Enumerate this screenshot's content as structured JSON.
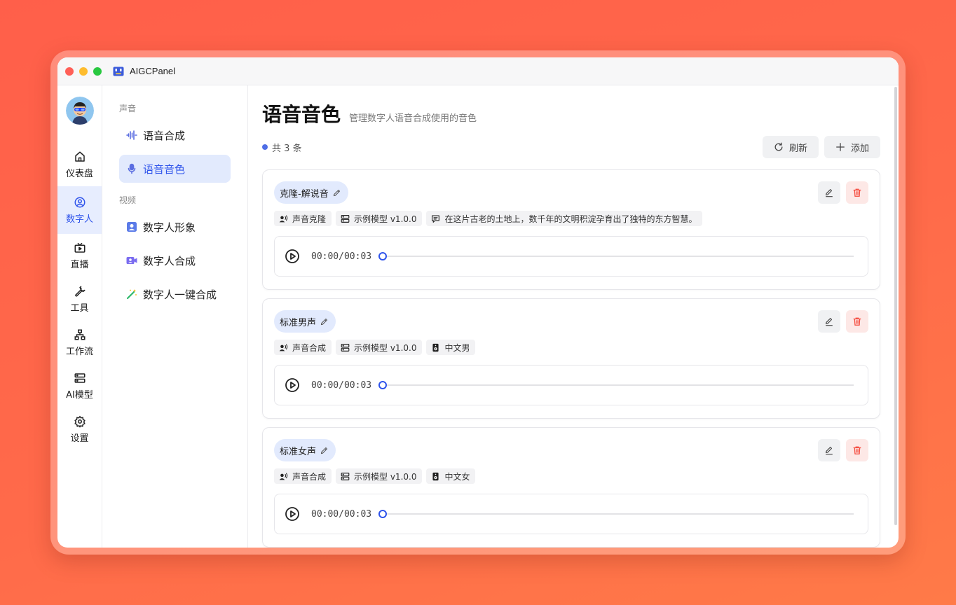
{
  "window": {
    "title": "AIGCPanel"
  },
  "rail": {
    "items": [
      {
        "label": "仪表盘"
      },
      {
        "label": "数字人"
      },
      {
        "label": "直播"
      },
      {
        "label": "工具"
      },
      {
        "label": "工作流"
      },
      {
        "label": "AI模型"
      },
      {
        "label": "设置"
      }
    ]
  },
  "subnav": {
    "sections": [
      {
        "label": "声音",
        "items": [
          {
            "label": "语音合成"
          },
          {
            "label": "语音音色"
          }
        ]
      },
      {
        "label": "视频",
        "items": [
          {
            "label": "数字人形象"
          },
          {
            "label": "数字人合成"
          },
          {
            "label": "数字人一键合成"
          }
        ]
      }
    ]
  },
  "main": {
    "title": "语音音色",
    "subtitle": "管理数字人语音合成使用的音色",
    "count_label": "共 3 条",
    "refresh_label": "刷新",
    "add_label": "添加",
    "cards": [
      {
        "name": "克隆-解说音",
        "tags": [
          {
            "label": "声音克隆",
            "icon": "voice-icon"
          },
          {
            "label": "示例模型 v1.0.0",
            "icon": "server-icon"
          },
          {
            "label": "在这片古老的土地上，数千年的文明积淀孕育出了独特的东方智慧。",
            "icon": "message-icon"
          }
        ],
        "time": "00:00/00:03",
        "progress": 0
      },
      {
        "name": "标准男声",
        "tags": [
          {
            "label": "声音合成",
            "icon": "voice-icon"
          },
          {
            "label": "示例模型 v1.0.0",
            "icon": "server-icon"
          },
          {
            "label": "中文男",
            "icon": "speaker-icon"
          }
        ],
        "time": "00:00/00:03",
        "progress": 0
      },
      {
        "name": "标准女声",
        "tags": [
          {
            "label": "声音合成",
            "icon": "voice-icon"
          },
          {
            "label": "示例模型 v1.0.0",
            "icon": "server-icon"
          },
          {
            "label": "中文女",
            "icon": "speaker-icon"
          }
        ],
        "time": "00:00/00:03",
        "progress": 0
      }
    ]
  },
  "colors": {
    "accent": "#2f54eb",
    "active_bg": "#e2eafd",
    "danger": "#f5483b"
  }
}
